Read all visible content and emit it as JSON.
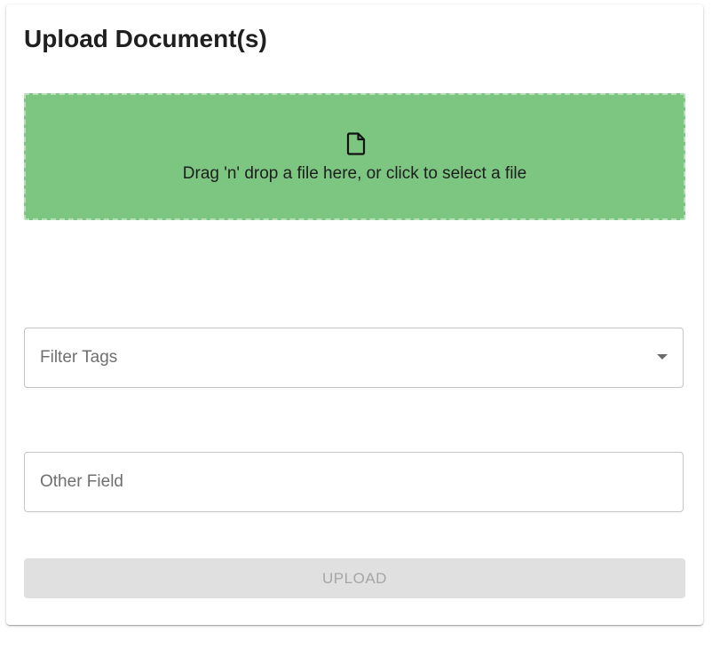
{
  "title": "Upload Document(s)",
  "dropzone": {
    "icon": "file-icon",
    "text": "Drag 'n' drop a file here, or click to select a file",
    "background_color": "#7dc681"
  },
  "filter_tags": {
    "label": "Filter Tags",
    "icon": "chevron-down-icon"
  },
  "other_field": {
    "label": "Other Field"
  },
  "upload_button": {
    "label": "UPLOAD",
    "disabled": true
  }
}
